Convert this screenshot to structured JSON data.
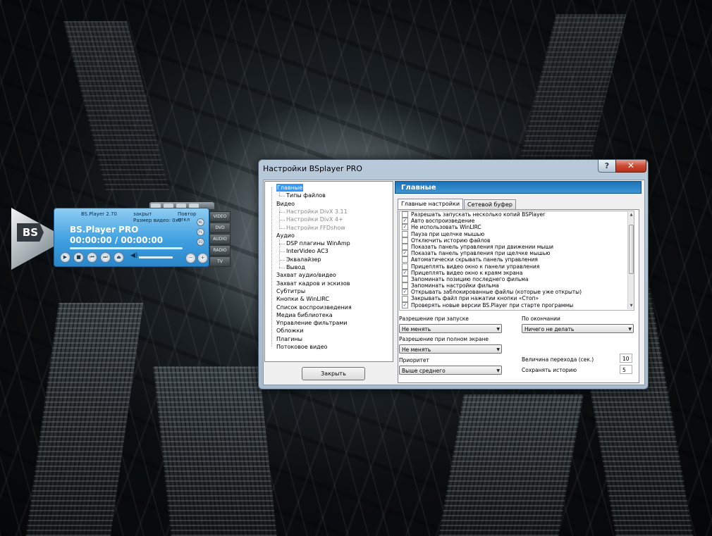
{
  "player": {
    "version": "BS.Player 2.70",
    "status": "закрыт",
    "repeat": "Повтор откл",
    "video_size": "Размер видео: 0x0",
    "title": "BS.Player PRO",
    "time": "00:00:00 / 00:00:00",
    "logo": "BS",
    "side_buttons": [
      "ML",
      "PL",
      "EQ"
    ],
    "tabs": [
      "VIDEO",
      "DVD",
      "AUDIO",
      "RADIO",
      "TV"
    ],
    "controls": [
      "play-icon",
      "stop-icon",
      "prev-icon",
      "next-icon",
      "eject-icon"
    ],
    "progress": 0
  },
  "dialog": {
    "title": "Настройки BSplayer PRO",
    "help": "?",
    "close": "✕",
    "close_button": "Закрыть"
  },
  "tree": [
    {
      "label": "Главные",
      "level": 0,
      "selected": true,
      "dim": false
    },
    {
      "label": "Типы файлов",
      "level": 1,
      "selected": false,
      "dim": false
    },
    {
      "label": "Видео",
      "level": 0,
      "selected": false,
      "dim": false
    },
    {
      "label": "Настройки DivX 3.11",
      "level": 1,
      "selected": false,
      "dim": true
    },
    {
      "label": "Настройки DivX 4+",
      "level": 1,
      "selected": false,
      "dim": true
    },
    {
      "label": "Настройки FFDshow",
      "level": 1,
      "selected": false,
      "dim": true
    },
    {
      "label": "Аудио",
      "level": 0,
      "selected": false,
      "dim": false
    },
    {
      "label": "DSP плагины WinAmp",
      "level": 1,
      "selected": false,
      "dim": false
    },
    {
      "label": "InterVideo AC3",
      "level": 1,
      "selected": false,
      "dim": false
    },
    {
      "label": "Эквалайзер",
      "level": 1,
      "selected": false,
      "dim": false
    },
    {
      "label": "Вывод",
      "level": 1,
      "selected": false,
      "dim": false
    },
    {
      "label": "Захват аудио/видео",
      "level": 0,
      "selected": false,
      "dim": false
    },
    {
      "label": "Захват кадров и эскизов",
      "level": 0,
      "selected": false,
      "dim": false
    },
    {
      "label": "Субтитры",
      "level": 0,
      "selected": false,
      "dim": false
    },
    {
      "label": "Кнопки & WinLIRC",
      "level": 0,
      "selected": false,
      "dim": false
    },
    {
      "label": "Список воспроизведения",
      "level": 0,
      "selected": false,
      "dim": false
    },
    {
      "label": "Медиа библиотека",
      "level": 0,
      "selected": false,
      "dim": false
    },
    {
      "label": "Управление фильтрами",
      "level": 0,
      "selected": false,
      "dim": false
    },
    {
      "label": "Обложки",
      "level": 0,
      "selected": false,
      "dim": false
    },
    {
      "label": "Плагины",
      "level": 0,
      "selected": false,
      "dim": false
    },
    {
      "label": "Потоковое видео",
      "level": 0,
      "selected": false,
      "dim": false
    }
  ],
  "panel": {
    "header": "Главные",
    "tabs": [
      {
        "label": "Главные настройки",
        "active": true
      },
      {
        "label": "Сетевой буфер",
        "active": false
      }
    ],
    "options": [
      {
        "label": "Разрешать запускать несколько копий BSPlayer",
        "checked": false
      },
      {
        "label": "Авто воспроизведение",
        "checked": true
      },
      {
        "label": "Не использовать WinLIRC",
        "checked": true
      },
      {
        "label": "Пауза при щелчке мышью",
        "checked": false
      },
      {
        "label": "Отключить историю файлов",
        "checked": false
      },
      {
        "label": "Показать панель управления при движении мыши",
        "checked": false
      },
      {
        "label": "Показать панель управления при щелчке мышью",
        "checked": true
      },
      {
        "label": "Автоматически скрывать панель управления",
        "checked": false
      },
      {
        "label": "Прицеплять видео окно к панели управления",
        "checked": false
      },
      {
        "label": "Прицеплять видео окно к краям экрана",
        "checked": true
      },
      {
        "label": "Запоминать позицию последнего фильма",
        "checked": false
      },
      {
        "label": "Запоминать настройки фильма",
        "checked": false
      },
      {
        "label": "Открывать заблокированные файлы (которые уже открыты)",
        "checked": true
      },
      {
        "label": "Закрывать файл при нажатии кнопки «Стоп»",
        "checked": false
      },
      {
        "label": "Проверять новые версии BS.Player при старте программы",
        "checked": true
      }
    ],
    "startup_res_label": "Разрешение при запуске",
    "startup_res_value": "Не менять",
    "fullscreen_res_label": "Разрешение при полном экране",
    "fullscreen_res_value": "Не менять",
    "priority_label": "Приоритет",
    "priority_value": "Выше среднего",
    "on_end_label": "По окончании",
    "on_end_value": "Ничего не делать",
    "jump_label": "Величина перехода (сек.)",
    "jump_value": "10",
    "history_label": "Сохранять историю",
    "history_value": "5"
  }
}
